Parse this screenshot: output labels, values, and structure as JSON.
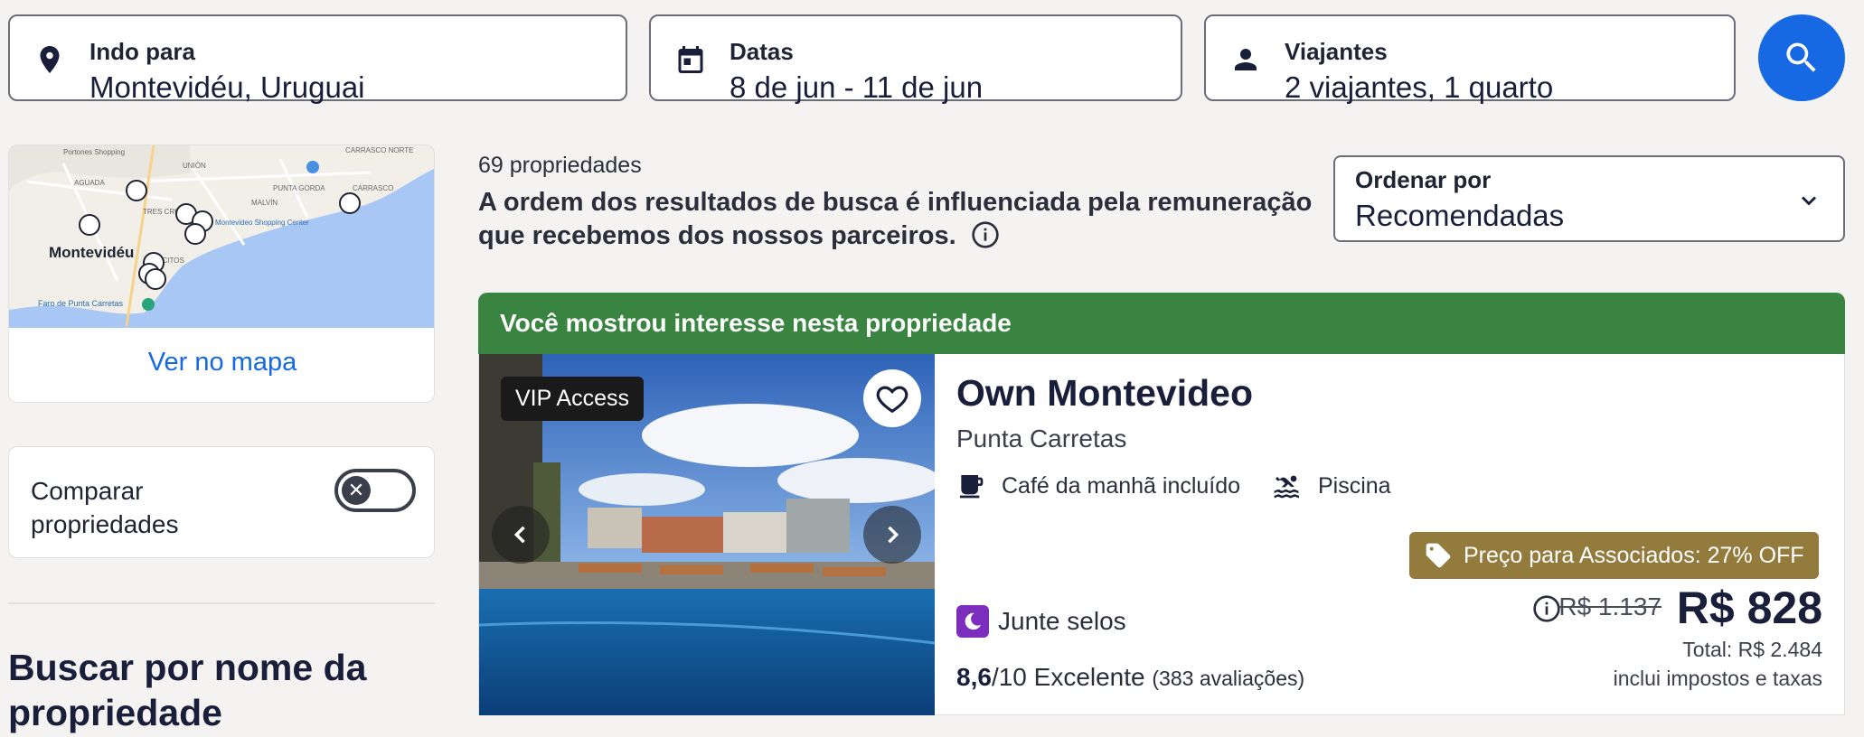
{
  "search": {
    "destination": {
      "label": "Indo para",
      "value": "Montevidéu, Uruguai"
    },
    "dates": {
      "label": "Datas",
      "value": "8 de jun - 11 de jun"
    },
    "travelers": {
      "label": "Viajantes",
      "value": "2 viajantes, 1 quarto"
    }
  },
  "map": {
    "city_label": "Montevidéu",
    "places": [
      "Portones Shopping",
      "CARRASCO NORTE",
      "PUNTA GORDA",
      "MALVÍN",
      "CARRASCO",
      "UNIÓN",
      "AGUADA",
      "TRES CRUCES",
      "POCITOS",
      "Faro de Punta Carretas",
      "Montevideo Shopping Center"
    ],
    "link": "Ver no mapa"
  },
  "compare": {
    "label": "Comparar propriedades"
  },
  "search_by_name": "Buscar por nome da propriedade",
  "results": {
    "count": "69 propriedades",
    "disclaimer": "A ordem dos resultados de busca é influenciada pela remuneração que recebemos dos nossos parceiros."
  },
  "sort": {
    "label": "Ordenar por",
    "value": "Recomendadas"
  },
  "banner": "Você mostrou interesse nesta propriedade",
  "hotel": {
    "badge": "VIP Access",
    "name": "Own Montevideo",
    "location": "Punta Carretas",
    "amenities": [
      "Café da manhã incluído",
      "Piscina"
    ],
    "member_badge": "Preço para Associados: 27% OFF",
    "stamps": "Junte selos",
    "rating_score": "8,6",
    "rating_scale": "/10 Excelente",
    "rating_reviews": "(383 avaliações)",
    "old_price": "R$ 1.137",
    "price": "R$ 828",
    "total": "Total: R$ 2.484",
    "taxes": "inclui impostos e taxas"
  },
  "colors": {
    "accent": "#1668e3",
    "banner": "#3a8441",
    "member": "#937b3e",
    "stamp": "#7b2dbd"
  }
}
